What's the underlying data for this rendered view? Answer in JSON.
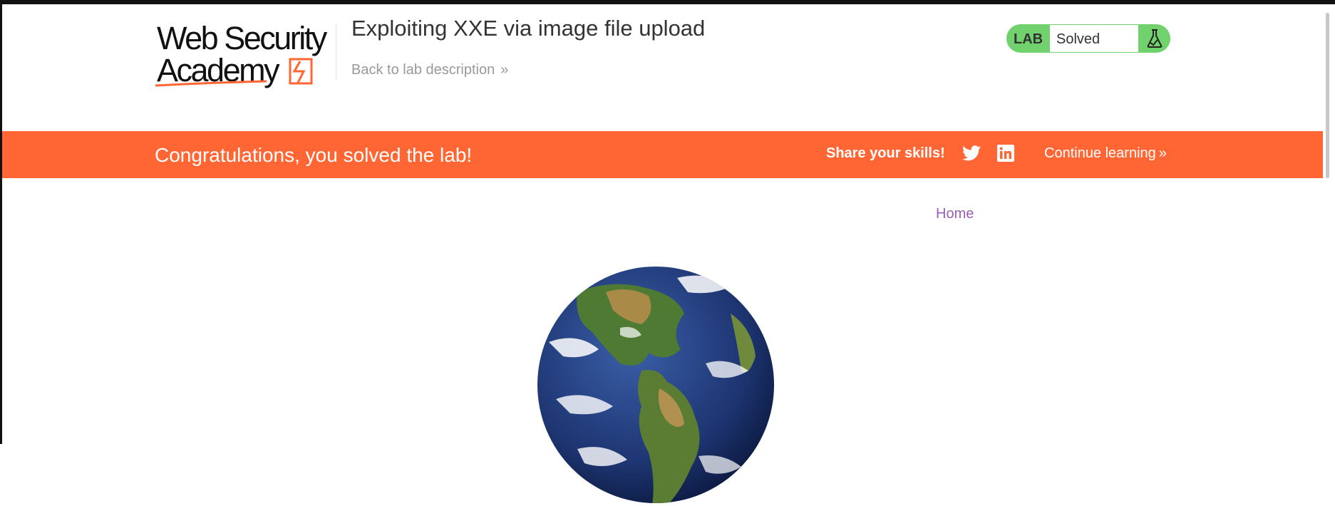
{
  "header": {
    "logo_line1": "Web Security",
    "logo_line2": "Academy",
    "lab_title": "Exploiting XXE via image file upload",
    "back_link": "Back to lab description",
    "lab_badge": "LAB",
    "lab_status": "Solved"
  },
  "banner": {
    "message": "Congratulations, you solved the lab!",
    "share_label": "Share your skills!",
    "continue_label": "Continue learning",
    "color": "#ff6633"
  },
  "nav": {
    "home_label": "Home"
  },
  "colors": {
    "accent": "#ff6633",
    "solved_green": "#70d16d",
    "link_purple": "#9a5fb5"
  },
  "icons": {
    "twitter": "twitter-icon",
    "linkedin": "linkedin-icon",
    "flask": "flask-icon",
    "chevron": "double-chevron-right-icon"
  }
}
